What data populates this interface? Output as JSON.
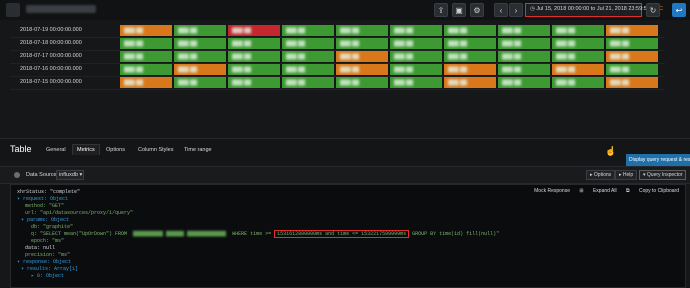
{
  "topbar": {
    "time_range": "Jul 15, 2018 00:00:00 to Jul 21, 2018 23:59:59",
    "utc": "UTC"
  },
  "grid": {
    "rows": [
      {
        "time": "2018-07-19 00:00:00.000",
        "cells": [
          "orange",
          "green",
          "red",
          "green",
          "green",
          "green",
          "green",
          "green",
          "green",
          "orange"
        ]
      },
      {
        "time": "2018-07-18 00:00:00.000",
        "cells": [
          "green",
          "green",
          "green",
          "green",
          "green",
          "green",
          "green",
          "green",
          "green",
          "green"
        ]
      },
      {
        "time": "2018-07-17 00:00:00.000",
        "cells": [
          "green",
          "green",
          "green",
          "green",
          "orange",
          "green",
          "green",
          "green",
          "green",
          "orange"
        ]
      },
      {
        "time": "2018-07-16 00:00:00.000",
        "cells": [
          "green",
          "orange",
          "green",
          "green",
          "orange",
          "green",
          "orange",
          "green",
          "orange",
          "green"
        ]
      },
      {
        "time": "2018-07-15 00:00:00.000",
        "cells": [
          "orange",
          "green",
          "green",
          "green",
          "green",
          "green",
          "orange",
          "green",
          "green",
          "orange"
        ]
      }
    ],
    "colors": {
      "green": "#3d9a32",
      "orange": "#d8781b",
      "red": "#c4272d"
    }
  },
  "editor": {
    "title": "Table",
    "tabs": [
      "General",
      "Metrics",
      "Options",
      "Column Styles",
      "Time range"
    ],
    "active_tab": "Metrics",
    "tooltip": "Display query request & response"
  },
  "datasource": {
    "label": "Data Source",
    "value": "influxdb",
    "options_label": "Options",
    "help_label": "Help",
    "inspector_label": "Query Inspector"
  },
  "inspector": {
    "mock": "Mock Response",
    "expand": "Expand All",
    "copy": "Copy to Clipboard",
    "lines": {
      "l1": "xhrStatus: \"complete\"",
      "l2": "request: Object",
      "l3": "method: \"GET\"",
      "l4": "url: \"api/datasources/proxy/1/query\"",
      "l5": "params: Object",
      "l6": "db: \"graphite\"",
      "l7a": "q: \"SELECT mean(\"UpOrDown\") FROM",
      "l7b": "WHERE time >=",
      "l7c": "1531612800000ms and time <= 1532217599999ms",
      "l7d": "GROUP BY time(1d) fill(null)\"",
      "l8": "epoch: \"ms\"",
      "l9": "data: null",
      "l10": "precision: \"ms\"",
      "l11": "response: Object",
      "l12": "results: Array[1]",
      "l13": "0: Object"
    }
  }
}
